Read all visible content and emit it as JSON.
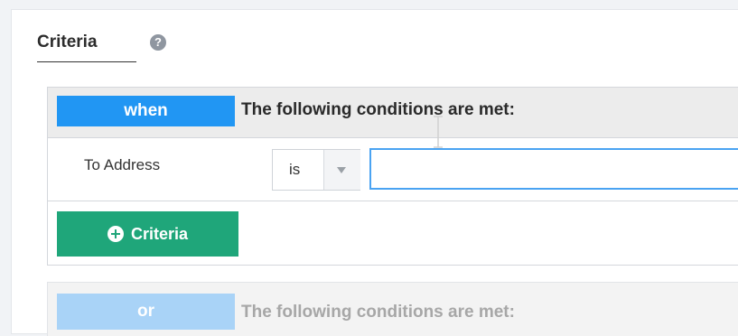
{
  "criteria_section": {
    "title": "Criteria",
    "help_icon": "question-circle-icon"
  },
  "groups": [
    {
      "operator": "when",
      "condition_text": "The following conditions are met:",
      "badge_color": "#2196f3",
      "rows": [
        {
          "field": "To Address",
          "operator": "is",
          "value": ""
        }
      ],
      "add_button_label": "Criteria",
      "add_button_icon": "plus-circle-icon",
      "add_button_color": "#1fa67a"
    },
    {
      "operator": "or",
      "condition_text": "The following conditions are met:",
      "badge_color": "#a9d3f7",
      "disabled": true
    }
  ]
}
